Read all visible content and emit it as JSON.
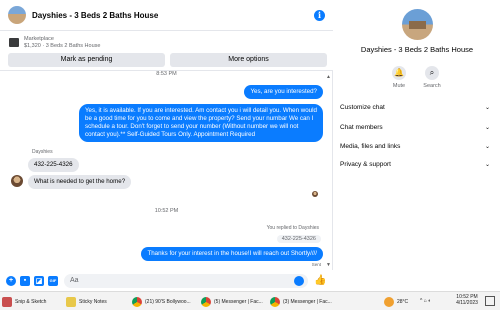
{
  "header": {
    "title": "Dayshies - 3 Beds 2 Baths House",
    "info_icon": "info-icon"
  },
  "marketplace": {
    "label": "Marketplace",
    "listing": "$1,320 · 3 Beds 2 Baths House",
    "mark_pending": "Mark as pending",
    "more_options": "More options"
  },
  "thread": {
    "timestamp_top": "8:53 PM",
    "msg_out_1": "Yes, are you interested?",
    "msg_out_2": "Yes, it is available. If you are interested.  Am contact you i will detail you.  When would be a good time for you to come and view the property? Send your numbar We can I schedule a tour.  Don't forget to send your number (Without number we will not contact you).** Self-Guided Tours Only. Appointment Required",
    "sender_name": "Dayshies",
    "msg_in_1": "432-225-4326",
    "msg_in_2": "What is needed to get the home?",
    "timestamp_mid": "10:52 PM",
    "reply_note": "You replied to Dayshies",
    "quoted": "432-225-4326",
    "msg_out_3": "Thanks for your interest in the house!I will reach out Shortly////",
    "sent_label": "Sent"
  },
  "composer": {
    "placeholder": "Aa"
  },
  "info": {
    "name": "Dayshies - 3 Beds 2 Baths House",
    "mute_label": "Mute",
    "search_label": "Search",
    "menu": [
      {
        "label": "Customize chat"
      },
      {
        "label": "Chat members"
      },
      {
        "label": "Media, files and links"
      },
      {
        "label": "Privacy & support"
      }
    ]
  },
  "taskbar": {
    "items": [
      {
        "label": "Snip & Sketch"
      },
      {
        "label": "Sticky Notes"
      },
      {
        "label": "(21) 90'S Bollywoo..."
      },
      {
        "label": "(5) Messenger | Fac..."
      },
      {
        "label": "(3) Messenger | Fac..."
      }
    ],
    "temperature": "28°C",
    "time": "10:52 PM",
    "date": "4/11/2023"
  },
  "colors": {
    "accent": "#0a7cff",
    "bubble_in": "#e4e6eb"
  }
}
